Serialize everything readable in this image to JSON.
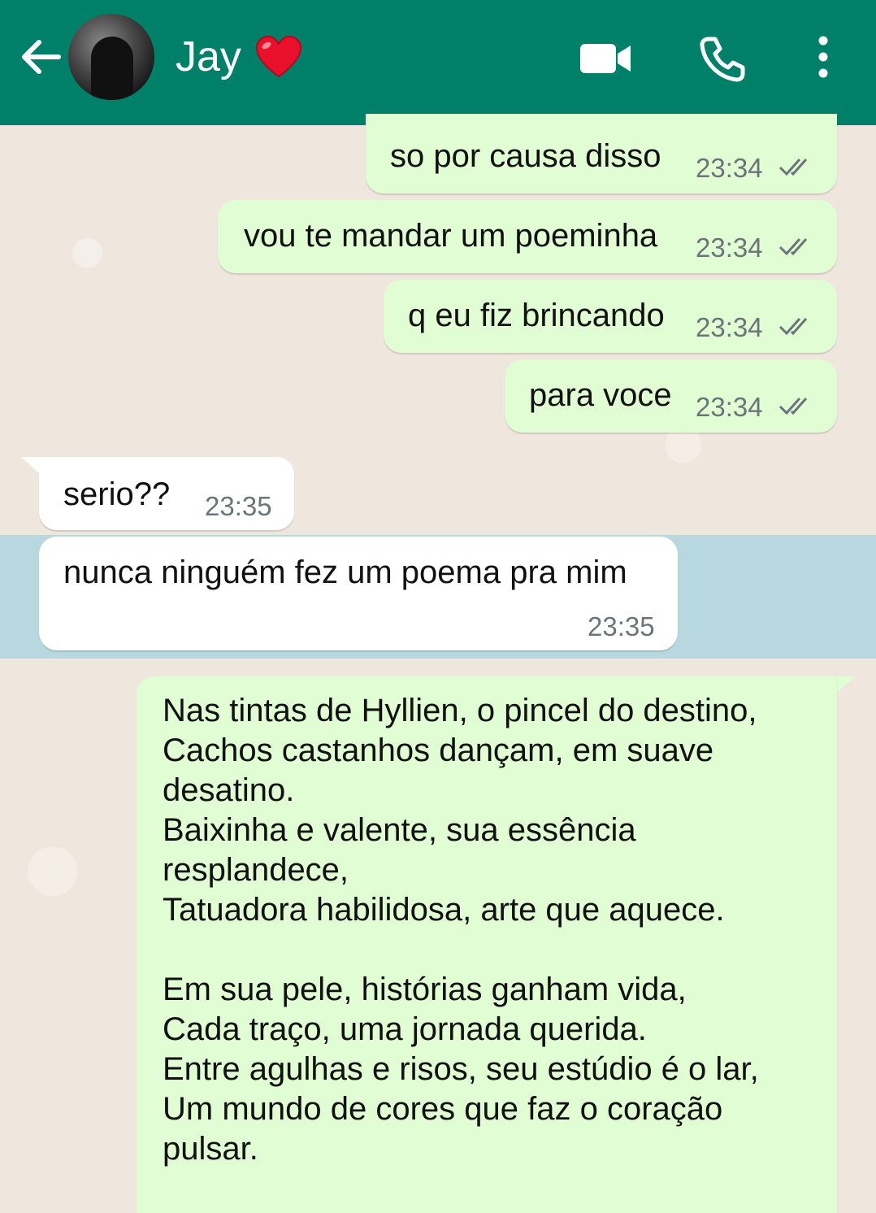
{
  "header": {
    "contact_name": "Jay",
    "heart_emoji": "❤️",
    "icons": [
      "arrow-left-icon",
      "avatar",
      "video-call-icon",
      "phone-icon",
      "more-vert-icon"
    ],
    "bar_color": "#008069"
  },
  "messages": [
    {
      "direction": "out",
      "text": "so por causa disso",
      "time": "23:34",
      "status": "read"
    },
    {
      "direction": "out",
      "text": "vou te mandar um poeminha",
      "time": "23:34",
      "status": "read"
    },
    {
      "direction": "out",
      "text": "q eu fiz brincando",
      "time": "23:34",
      "status": "read"
    },
    {
      "direction": "out",
      "text": "para voce",
      "time": "23:34",
      "status": "read"
    },
    {
      "direction": "in",
      "text": "serio??",
      "time": "23:35"
    },
    {
      "direction": "in",
      "text": "nunca ninguém fez um poema pra mim",
      "time": "23:35",
      "highlighted": true
    }
  ],
  "poem": {
    "lines": [
      "Nas tintas de Hyllien, o pincel do destino,",
      "Cachos castanhos dançam, em suave",
      "desatino.",
      "Baixinha e valente, sua essência",
      "resplandece,",
      "Tatuadora habilidosa, arte que aquece.",
      "",
      "Em sua pele, histórias ganham vida,",
      "Cada traço, uma jornada querida.",
      "Entre agulhas e risos, seu estúdio é o lar,",
      "Um mundo de cores que faz o coração",
      "pulsar."
    ]
  },
  "colors": {
    "outgoing_bubble": "#e1fdd3",
    "incoming_bubble": "#ffffff",
    "chat_background": "#efe6dd",
    "selected_highlight": "#b8d8e0",
    "read_ticks": "#6b7479"
  }
}
